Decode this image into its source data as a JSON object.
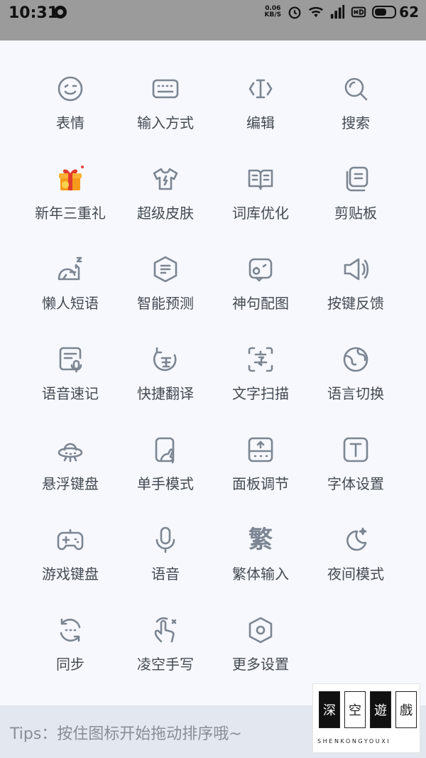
{
  "status_bar": {
    "time": "10:31",
    "speed_value": "0.06",
    "speed_unit": "KB/S",
    "battery_level": "62",
    "battery_fraction": 0.62
  },
  "grid": {
    "items": [
      {
        "label": "表情",
        "icon": "smiley-icon"
      },
      {
        "label": "输入方式",
        "icon": "keyboard-icon"
      },
      {
        "label": "编辑",
        "icon": "cursor-edit-icon"
      },
      {
        "label": "搜索",
        "icon": "search-icon"
      },
      {
        "label": "新年三重礼",
        "icon": "gift-box-icon"
      },
      {
        "label": "超级皮肤",
        "icon": "tshirt-icon"
      },
      {
        "label": "词库优化",
        "icon": "open-book-icon"
      },
      {
        "label": "剪贴板",
        "icon": "clipboard-icon"
      },
      {
        "label": "懒人短语",
        "icon": "sleeping-cat-icon"
      },
      {
        "label": "智能预测",
        "icon": "hexagon-list-icon"
      },
      {
        "label": "神句配图",
        "icon": "emoji-bubble-icon"
      },
      {
        "label": "按键反馈",
        "icon": "speaker-vibrate-icon"
      },
      {
        "label": "语音速记",
        "icon": "voice-note-icon"
      },
      {
        "label": "快捷翻译",
        "icon": "translate-icon"
      },
      {
        "label": "文字扫描",
        "icon": "scan-text-icon"
      },
      {
        "label": "语言切换",
        "icon": "globe-icon"
      },
      {
        "label": "悬浮键盘",
        "icon": "ufo-icon"
      },
      {
        "label": "单手模式",
        "icon": "one-hand-icon"
      },
      {
        "label": "面板调节",
        "icon": "panel-adjust-icon"
      },
      {
        "label": "字体设置",
        "icon": "font-icon"
      },
      {
        "label": "游戏键盘",
        "icon": "gamepad-icon"
      },
      {
        "label": "语音",
        "icon": "microphone-icon"
      },
      {
        "label": "繁体输入",
        "icon": "traditional-char-icon",
        "glyph": "繁"
      },
      {
        "label": "夜间模式",
        "icon": "moon-icon"
      },
      {
        "label": "同步",
        "icon": "sync-icon"
      },
      {
        "label": "凌空手写",
        "icon": "handwriting-icon"
      },
      {
        "label": "更多设置",
        "icon": "settings-hexagon-icon"
      }
    ]
  },
  "tips": {
    "text": "Tips：按住图标开始拖动排序哦~"
  },
  "watermark": {
    "chars": [
      "深",
      "空",
      "遊",
      "戲"
    ],
    "subtitle": "SHENKONGYOUXI"
  },
  "colors": {
    "icon": "#7c8592",
    "label": "#444a52",
    "status_bar": "#9b9b9b",
    "tips_bg": "#e3e7ef",
    "background": "#f6f8fd"
  }
}
